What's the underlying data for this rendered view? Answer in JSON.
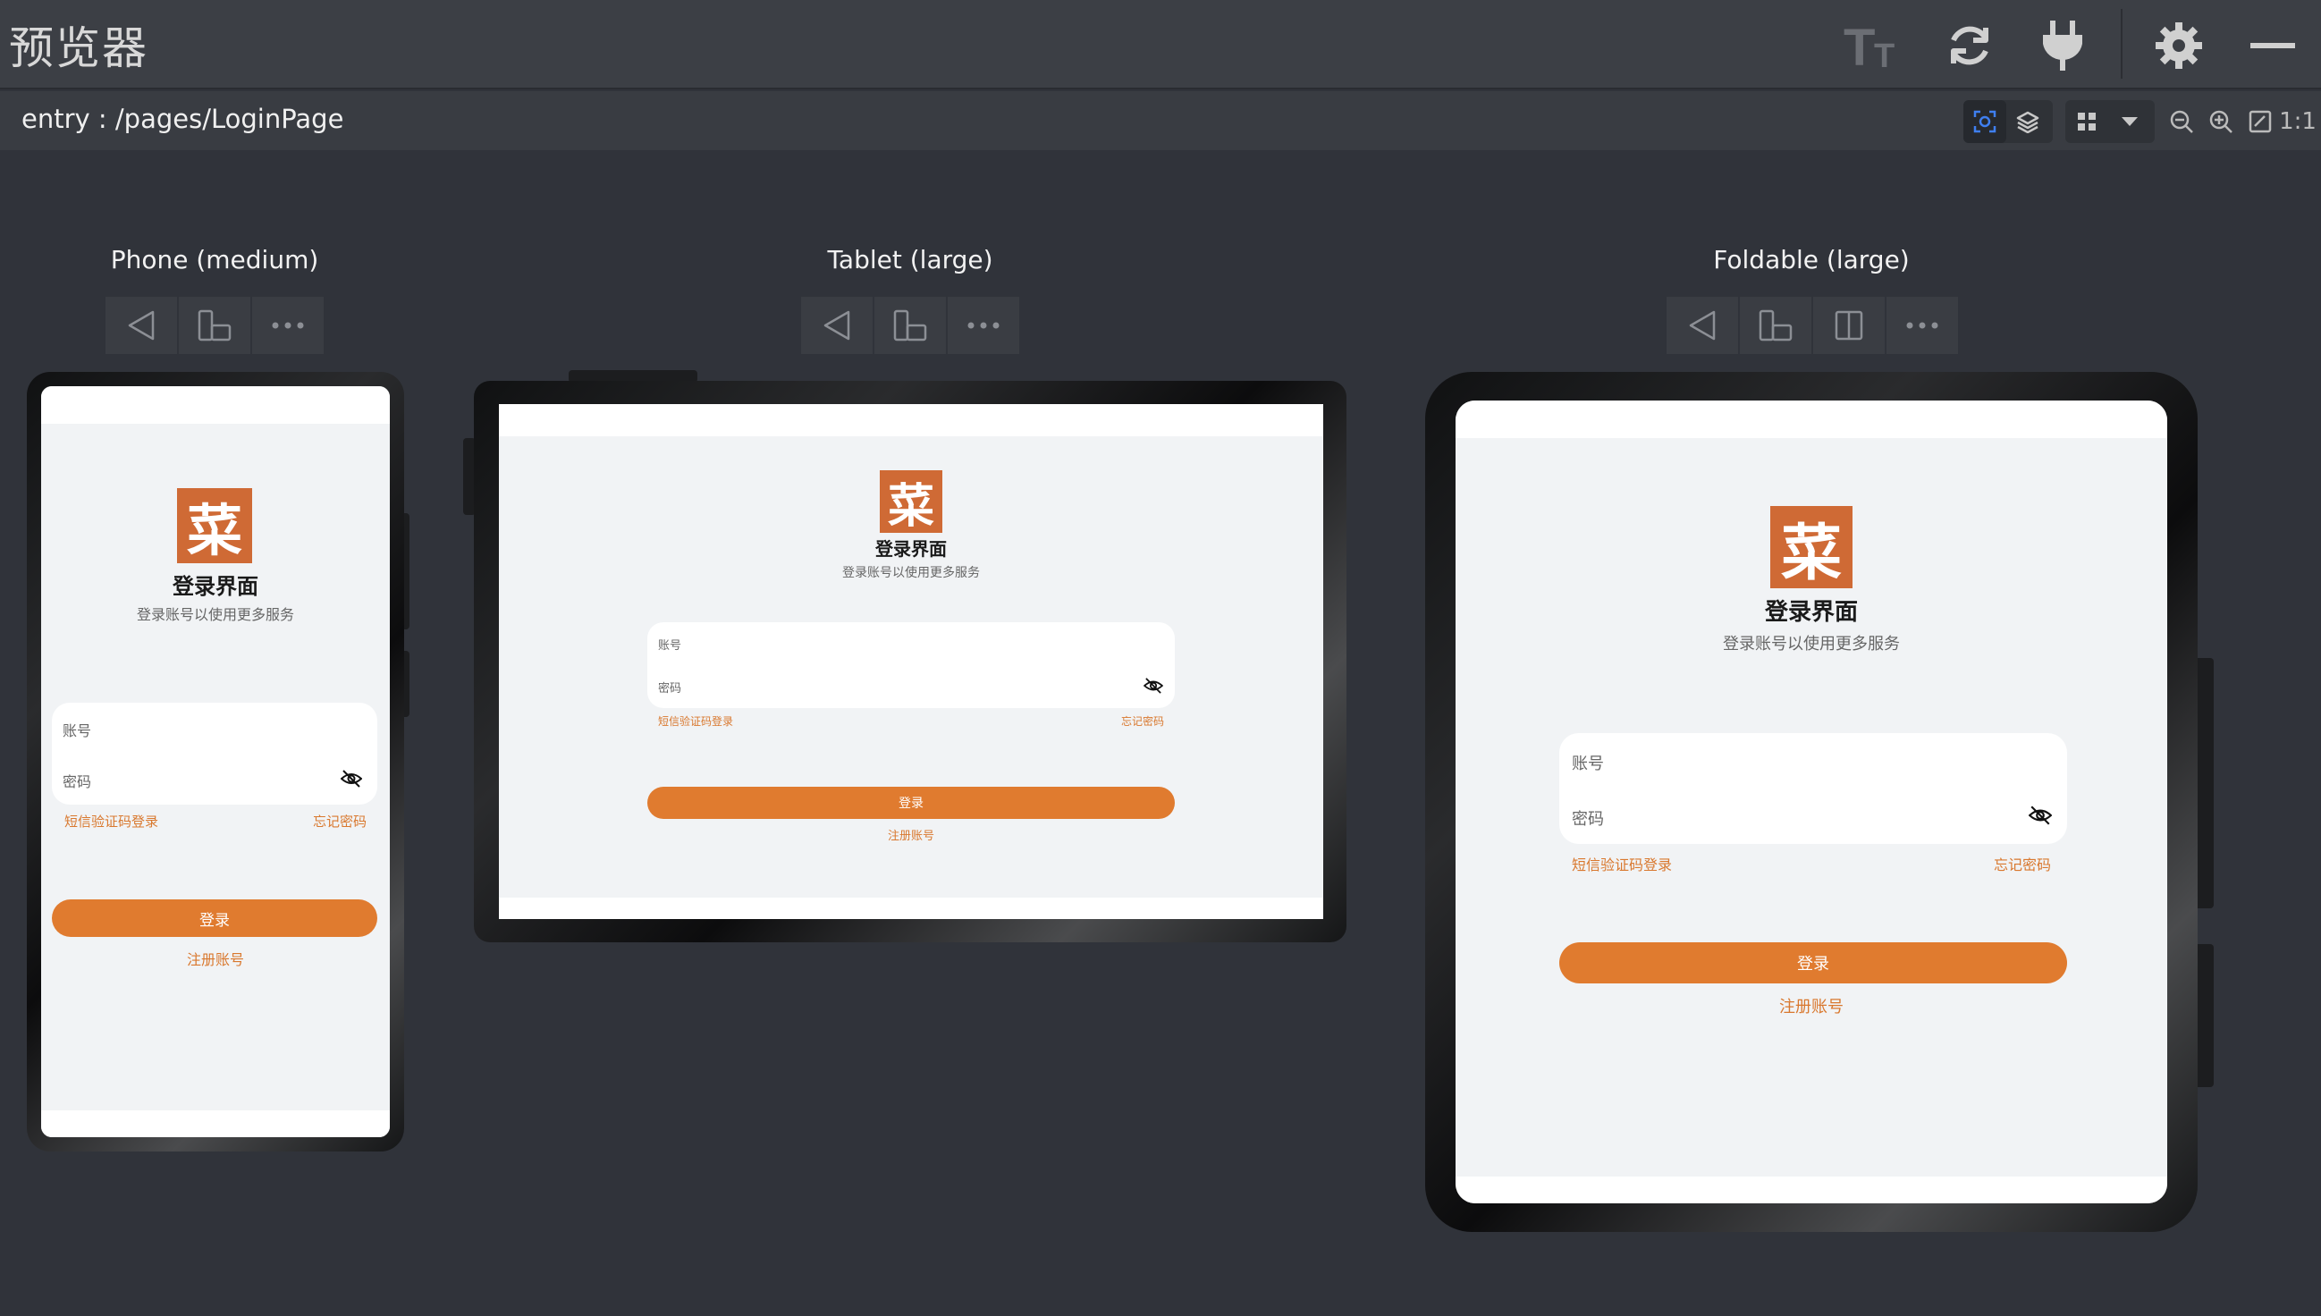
{
  "app": {
    "title": "预览器"
  },
  "pathbar": {
    "path": "entry : /pages/LoginPage",
    "ratio_label": "1:1"
  },
  "devices": [
    {
      "name": "Phone (medium)"
    },
    {
      "name": "Tablet (large)"
    },
    {
      "name": "Foldable (large)"
    }
  ],
  "login": {
    "logo_char": "菜",
    "title": "登录界面",
    "subtitle": "登录账号以使用更多服务",
    "account_placeholder": "账号",
    "password_placeholder": "密码",
    "sms_login": "短信验证码登录",
    "forgot_password": "忘记密码",
    "login_button": "登录",
    "register": "注册账号"
  },
  "colors": {
    "accent": "#e07b2f",
    "logo": "#cf6a35",
    "link": "#d9782e"
  }
}
